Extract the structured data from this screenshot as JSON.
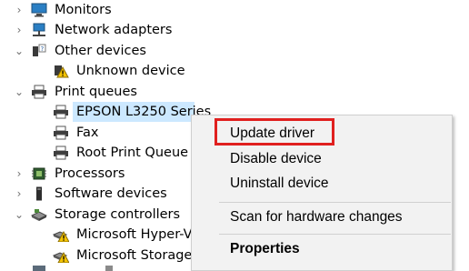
{
  "tree": {
    "items": [
      {
        "label": "Monitors",
        "icon": "monitor-icon",
        "expanded": false
      },
      {
        "label": "Network adapters",
        "icon": "network-adapter-icon",
        "expanded": false
      },
      {
        "label": "Other devices",
        "icon": "other-devices-icon",
        "expanded": true
      },
      {
        "label": "Unknown device",
        "icon": "unknown-device-warning-icon"
      },
      {
        "label": "Print queues",
        "icon": "printer-icon",
        "expanded": true
      },
      {
        "label": "EPSON L3250 Series",
        "icon": "printer-icon",
        "selected": true
      },
      {
        "label": "Fax",
        "icon": "printer-icon"
      },
      {
        "label": "Root Print Queue",
        "icon": "printer-icon"
      },
      {
        "label": "Processors",
        "icon": "processor-icon",
        "expanded": false
      },
      {
        "label": "Software devices",
        "icon": "software-device-icon",
        "expanded": false
      },
      {
        "label": "Storage controllers",
        "icon": "storage-controller-icon",
        "expanded": true
      },
      {
        "label": "Microsoft Hyper-V S",
        "icon": "storage-controller-warning-icon"
      },
      {
        "label": "Microsoft Storage S",
        "icon": "storage-controller-warning-icon"
      }
    ]
  },
  "context_menu": {
    "items": [
      {
        "label": "Update driver",
        "highlighted": true
      },
      {
        "label": "Disable device"
      },
      {
        "label": "Uninstall device"
      },
      {
        "label": "Scan for hardware changes"
      },
      {
        "label": "Properties",
        "bold": true
      }
    ]
  },
  "colors": {
    "selection": "#cce8ff",
    "highlight_box": "#e0201f",
    "menu_bg": "#f2f2f2"
  }
}
